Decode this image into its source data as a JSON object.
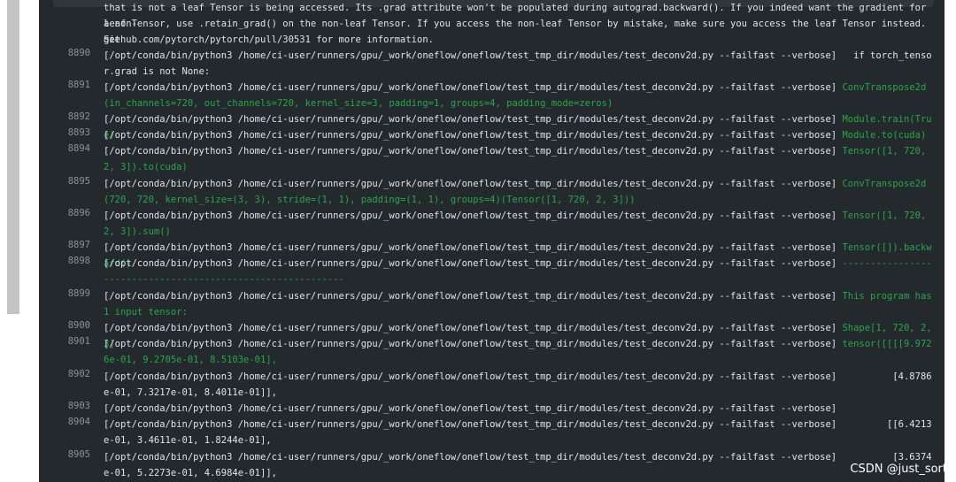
{
  "log": {
    "intro": [
      "that is not a leaf Tensor is being accessed. Its .grad attribute won't be populated during autograd.backward(). If you indeed want the gradient for a non-",
      "leaf Tensor, use .retain_grad() on the non-leaf Tensor. If you access the non-leaf Tensor by mistake, make sure you access the leaf Tensor instead. See",
      "github.com/pytorch/pytorch/pull/30531 for more information."
    ],
    "lines": [
      {
        "num": "8890",
        "cmd": "[/opt/conda/bin/python3 /home/ci-user/runners/gpu/_work/oneflow/oneflow/test_tmp_dir/modules/test_deconv2d.py --failfast --verbose]",
        "out": "   if torch_tensor.grad is not None:"
      },
      {
        "num": "8891",
        "cmd": "[/opt/conda/bin/python3 /home/ci-user/runners/gpu/_work/oneflow/oneflow/test_tmp_dir/modules/test_deconv2d.py --failfast --verbose]",
        "out": " ConvTranspose2d(in_channels=720, out_channels=720, kernel_size=3, padding=1, groups=4, padding_mode=zeros)"
      },
      {
        "num": "8892",
        "cmd": "[/opt/conda/bin/python3 /home/ci-user/runners/gpu/_work/oneflow/oneflow/test_tmp_dir/modules/test_deconv2d.py --failfast --verbose]",
        "out": " Module.train(True)"
      },
      {
        "num": "8893",
        "cmd": "[/opt/conda/bin/python3 /home/ci-user/runners/gpu/_work/oneflow/oneflow/test_tmp_dir/modules/test_deconv2d.py --failfast --verbose]",
        "out": " Module.to(cuda)"
      },
      {
        "num": "8894",
        "cmd": "[/opt/conda/bin/python3 /home/ci-user/runners/gpu/_work/oneflow/oneflow/test_tmp_dir/modules/test_deconv2d.py --failfast --verbose]",
        "out": " Tensor([1, 720, 2, 3]).to(cuda)"
      },
      {
        "num": "8895",
        "cmd": "[/opt/conda/bin/python3 /home/ci-user/runners/gpu/_work/oneflow/oneflow/test_tmp_dir/modules/test_deconv2d.py --failfast --verbose]",
        "out": " ConvTranspose2d(720, 720, kernel_size=(3, 3), stride=(1, 1), padding=(1, 1), groups=4)(Tensor([1, 720, 2, 3]))"
      },
      {
        "num": "8896",
        "cmd": "[/opt/conda/bin/python3 /home/ci-user/runners/gpu/_work/oneflow/oneflow/test_tmp_dir/modules/test_deconv2d.py --failfast --verbose]",
        "out": " Tensor([1, 720, 2, 3]).sum()"
      },
      {
        "num": "8897",
        "cmd": "[/opt/conda/bin/python3 /home/ci-user/runners/gpu/_work/oneflow/oneflow/test_tmp_dir/modules/test_deconv2d.py --failfast --verbose]",
        "out": " Tensor([]).backward()"
      },
      {
        "num": "8898",
        "cmd": "[/opt/conda/bin/python3 /home/ci-user/runners/gpu/_work/oneflow/oneflow/test_tmp_dir/modules/test_deconv2d.py --failfast --verbose]",
        "out": " -----------------------------------------------------------"
      },
      {
        "num": "8899",
        "cmd": "[/opt/conda/bin/python3 /home/ci-user/runners/gpu/_work/oneflow/oneflow/test_tmp_dir/modules/test_deconv2d.py --failfast --verbose]",
        "out": " This program has 1 input tensor:"
      },
      {
        "num": "8900",
        "cmd": "[/opt/conda/bin/python3 /home/ci-user/runners/gpu/_work/oneflow/oneflow/test_tmp_dir/modules/test_deconv2d.py --failfast --verbose]",
        "out": " Shape[1, 720, 2, 3]"
      },
      {
        "num": "8901",
        "cmd": "[/opt/conda/bin/python3 /home/ci-user/runners/gpu/_work/oneflow/oneflow/test_tmp_dir/modules/test_deconv2d.py --failfast --verbose]",
        "out": " tensor([[[[9.9726e-01, 9.2705e-01, 8.5103e-01],"
      },
      {
        "num": "8902",
        "cmd": "[/opt/conda/bin/python3 /home/ci-user/runners/gpu/_work/oneflow/oneflow/test_tmp_dir/modules/test_deconv2d.py --failfast --verbose]",
        "out": "          [4.8786e-01, 7.3217e-01, 8.4011e-01]],"
      },
      {
        "num": "8903",
        "cmd": "[/opt/conda/bin/python3 /home/ci-user/runners/gpu/_work/oneflow/oneflow/test_tmp_dir/modules/test_deconv2d.py --failfast --verbose]",
        "out": ""
      },
      {
        "num": "8904",
        "cmd": "[/opt/conda/bin/python3 /home/ci-user/runners/gpu/_work/oneflow/oneflow/test_tmp_dir/modules/test_deconv2d.py --failfast --verbose]",
        "out": "         [[6.4213e-01, 3.4611e-01, 1.8244e-01],"
      },
      {
        "num": "8905",
        "cmd": "[/opt/conda/bin/python3 /home/ci-user/runners/gpu/_work/oneflow/oneflow/test_tmp_dir/modules/test_deconv2d.py --failfast --verbose]",
        "out": "          [3.6374e-01, 5.2273e-01, 4.6984e-01]],"
      }
    ]
  },
  "watermark": "CSDN @just_sort",
  "colors": {
    "panel_bg": "#24292e",
    "text": "#e1e4e8",
    "line_number": "#8a939c",
    "output_green": "#28a745"
  }
}
